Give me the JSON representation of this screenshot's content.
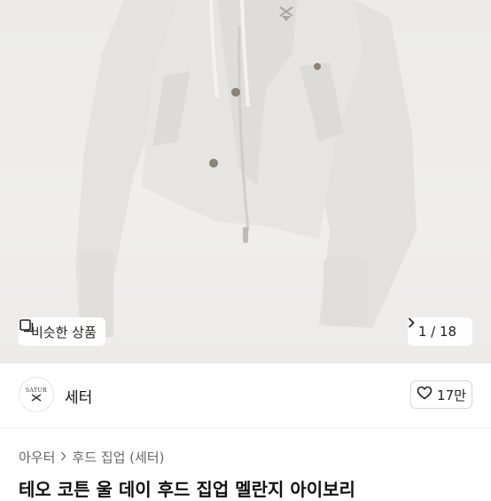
{
  "product_image": {
    "alt": "light grey zip-up hoodie"
  },
  "similar_button": {
    "label": "비슷한 상품",
    "icon": "similar-items-icon"
  },
  "image_counter": {
    "text": "1 / 18",
    "icon": "chevron-right-icon"
  },
  "shop": {
    "logo_text": "SATUR",
    "name": "세터"
  },
  "like_button": {
    "count": "17만",
    "icon": "heart-icon"
  },
  "breadcrumb": {
    "items": [
      "아우터",
      "후드 집업 (세터)"
    ],
    "separator_icon": "chevron-right-icon"
  },
  "product": {
    "title": "테오 코튼 울 데이 후드 집업 멜란지 아이보리"
  }
}
